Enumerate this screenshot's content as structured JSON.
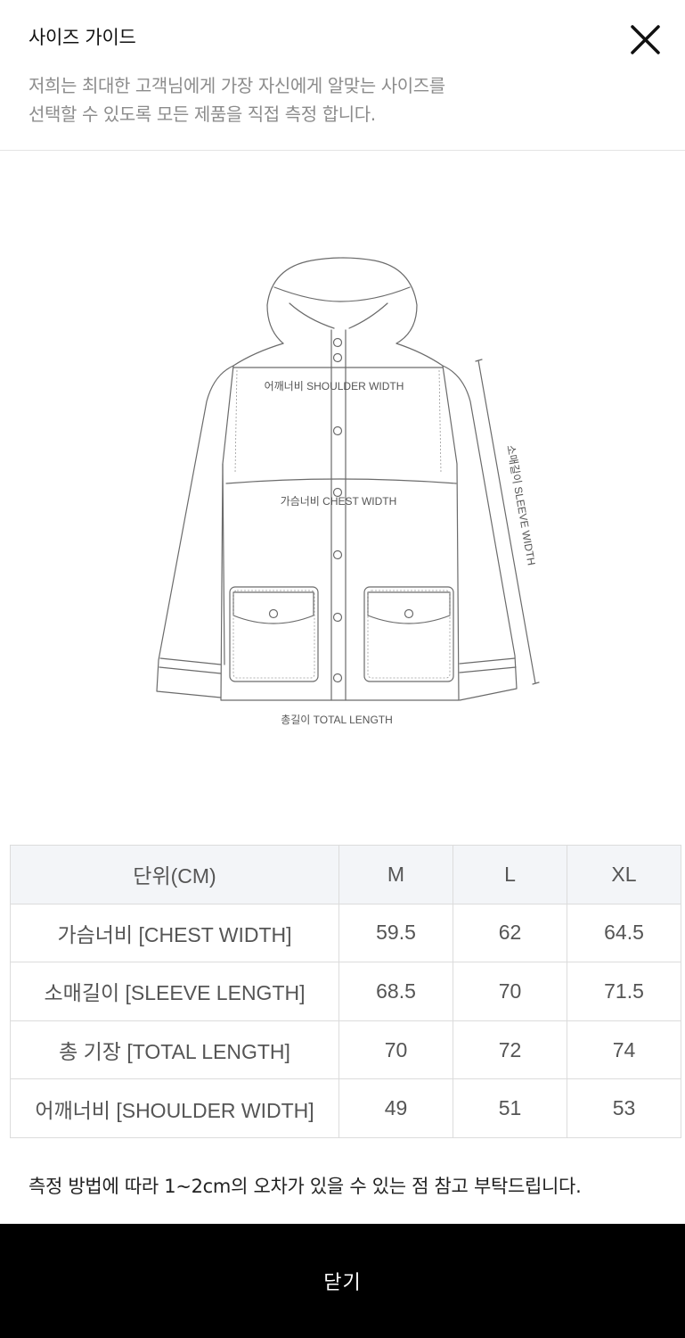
{
  "header": {
    "title": "사이즈 가이드",
    "description_line1": "저희는 최대한 고객님에게 가장 자신에게 알맞는 사이즈를",
    "description_line2": "선택할 수 있도록 모든 제품을 직접 측정 합니다."
  },
  "illustration": {
    "shoulder_label": "어깨너비 SHOULDER WIDTH",
    "chest_label": "가슴너비 CHEST WIDTH",
    "sleeve_label": "소매길이 SLEEVE WIDTH",
    "total_label": "총길이 TOTAL LENGTH"
  },
  "table": {
    "header": [
      "단위(CM)",
      "M",
      "L",
      "XL"
    ],
    "rows": [
      [
        "가슴너비 [CHEST WIDTH]",
        "59.5",
        "62",
        "64.5"
      ],
      [
        "소매길이 [SLEEVE LENGTH]",
        "68.5",
        "70",
        "71.5"
      ],
      [
        "총 기장 [TOTAL LENGTH]",
        "70",
        "72",
        "74"
      ],
      [
        "어깨너비 [SHOULDER WIDTH]",
        "49",
        "51",
        "53"
      ]
    ]
  },
  "note": "측정 방법에 따라 1~2cm의 오차가 있을 수 있는 점 참고 부탁드립니다.",
  "bottom": {
    "close_label": "닫기"
  },
  "colors": {
    "bottom_bar": "#000000",
    "table_header_bg": "#f3f5f8",
    "description": "#8c8c8c"
  }
}
